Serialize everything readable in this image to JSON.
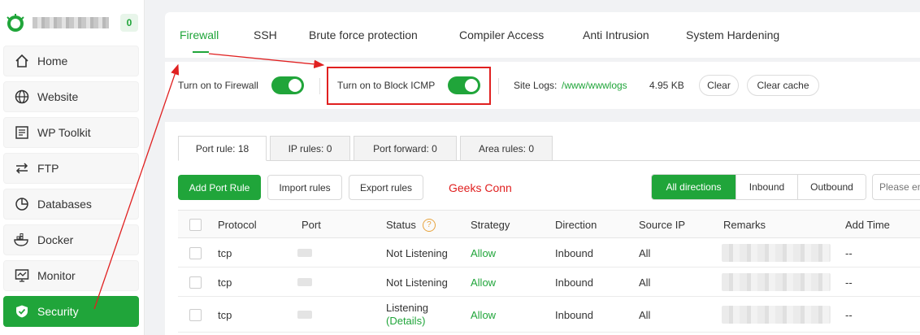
{
  "sidebar": {
    "badge_count": "0",
    "items": [
      {
        "label": "Home",
        "icon": "home-icon"
      },
      {
        "label": "Website",
        "icon": "globe-icon"
      },
      {
        "label": "WP Toolkit",
        "icon": "wp-toolkit-icon"
      },
      {
        "label": "FTP",
        "icon": "transfer-arrows-icon"
      },
      {
        "label": "Databases",
        "icon": "database-pie-icon"
      },
      {
        "label": "Docker",
        "icon": "docker-icon"
      },
      {
        "label": "Monitor",
        "icon": "monitor-icon"
      },
      {
        "label": "Security",
        "icon": "shield-icon",
        "active": true
      }
    ]
  },
  "tabs": [
    "Firewall",
    "SSH",
    "Brute force protection",
    "Compiler Access",
    "Anti Intrusion",
    "System Hardening"
  ],
  "firewall_bar": {
    "firewall_toggle_label": "Turn on to Firewall",
    "firewall_on": true,
    "icmp_toggle_label": "Turn on to Block ICMP",
    "icmp_on": true,
    "site_logs_label": "Site Logs:",
    "site_logs_path": "/www/wwwlogs",
    "logs_size": "4.95 KB",
    "clear_label": "Clear",
    "clear_cache_label": "Clear cache"
  },
  "sub_tabs": [
    "Port rule: 18",
    "IP rules: 0",
    "Port forward: 0",
    "Area rules: 0"
  ],
  "toolbar": {
    "add_port_rule": "Add Port Rule",
    "import_rules": "Import rules",
    "export_rules": "Export rules",
    "annotation": "Geeks Conn",
    "directions": [
      "All directions",
      "Inbound",
      "Outbound"
    ],
    "search_placeholder": "Please en"
  },
  "table": {
    "headers": [
      "Protocol",
      "Port",
      "Status",
      "Strategy",
      "Direction",
      "Source IP",
      "Remarks",
      "Add Time"
    ],
    "rows": [
      {
        "protocol": "tcp",
        "status": "Not Listening",
        "strategy": "Allow",
        "direction": "Inbound",
        "source_ip": "All",
        "add_time": "--"
      },
      {
        "protocol": "tcp",
        "status": "Not Listening",
        "strategy": "Allow",
        "direction": "Inbound",
        "source_ip": "All",
        "add_time": "--"
      },
      {
        "protocol": "tcp",
        "status": "Listening",
        "status_link": "(Details)",
        "strategy": "Allow",
        "direction": "Inbound",
        "source_ip": "All",
        "add_time": "--"
      }
    ]
  },
  "colors": {
    "accent": "#20a53a",
    "annotation": "#e02020"
  }
}
